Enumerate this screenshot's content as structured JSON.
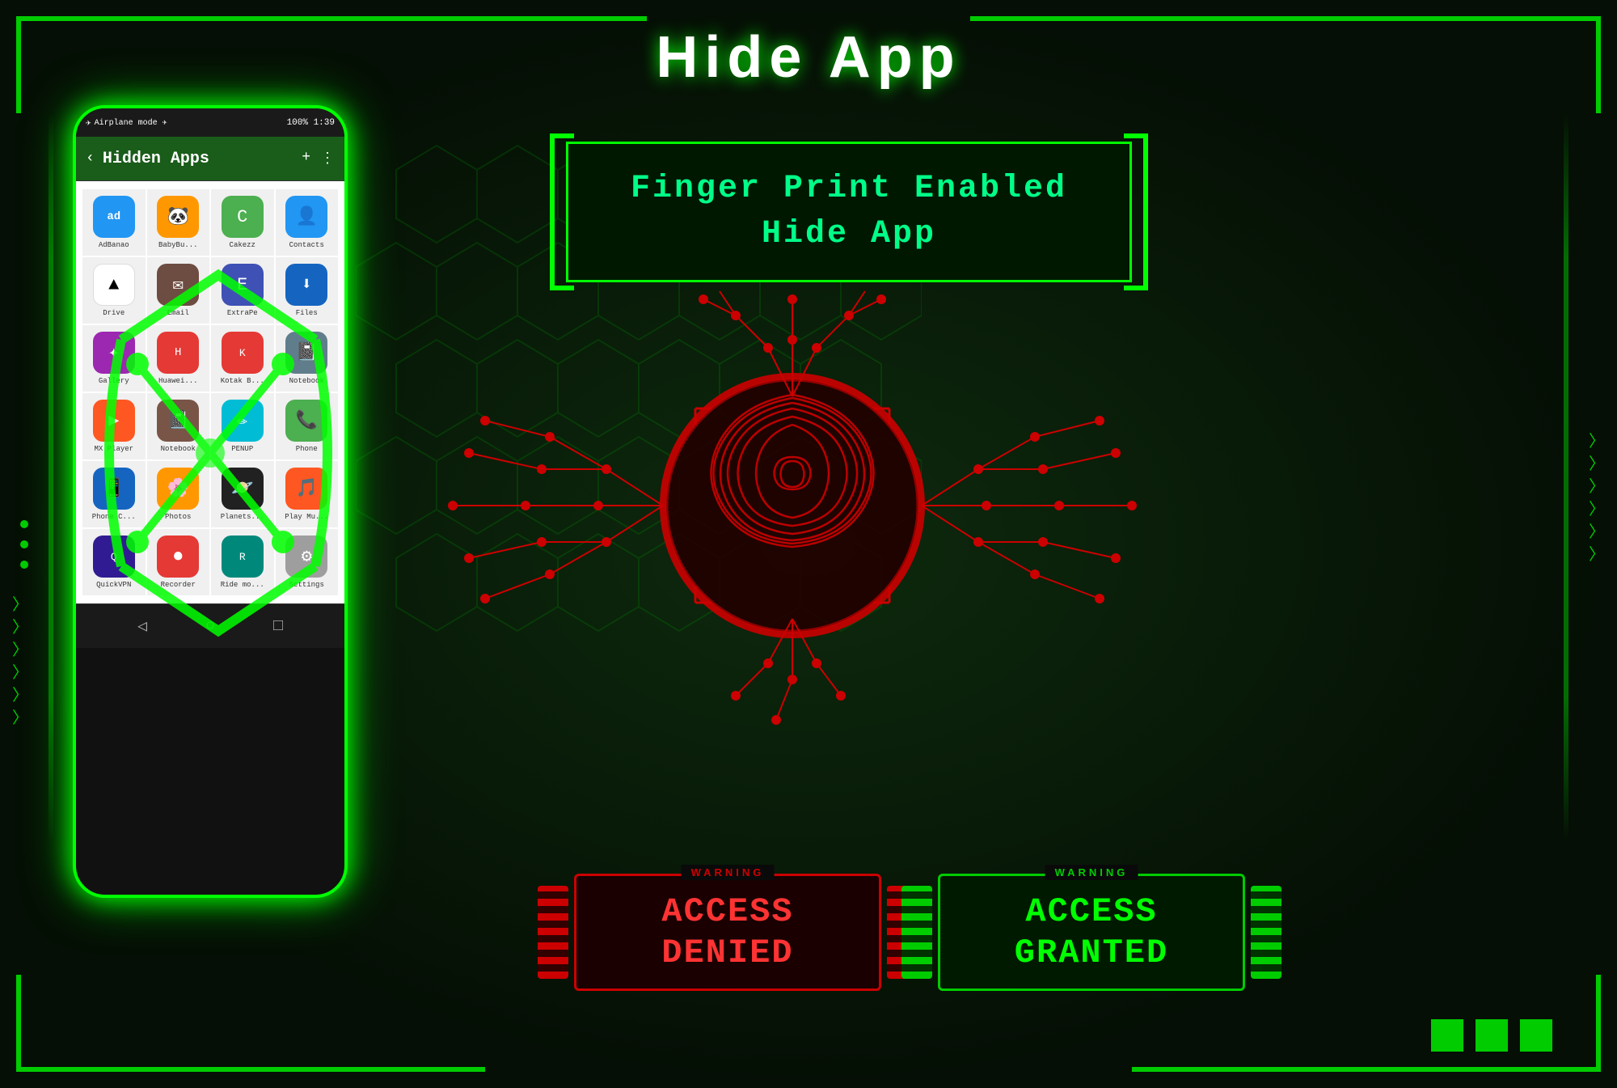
{
  "page": {
    "title": "Hide App",
    "background_color": "#0a1a0a"
  },
  "phone": {
    "status_bar": {
      "left": "Airplane mode ✈",
      "right": "100% 1:39"
    },
    "header": {
      "title": "Hidden Apps",
      "back_icon": "‹",
      "add_icon": "+",
      "more_icon": "⋮"
    },
    "apps": [
      {
        "label": "AdBanao",
        "icon": "ad",
        "color": "icon-ad"
      },
      {
        "label": "BabyBu...",
        "icon": "🐼",
        "color": "icon-baby"
      },
      {
        "label": "Cakezz",
        "icon": "C",
        "color": "icon-cake"
      },
      {
        "label": "Contacts",
        "icon": "👤",
        "color": "icon-contacts"
      },
      {
        "label": "Drive",
        "icon": "▲",
        "color": "icon-drive"
      },
      {
        "label": "Email",
        "icon": "✉",
        "color": "icon-email"
      },
      {
        "label": "ExtraPe",
        "icon": "E",
        "color": "icon-extrap"
      },
      {
        "label": "Files",
        "icon": "⬇",
        "color": "icon-files"
      },
      {
        "label": "Gallery",
        "icon": "✦",
        "color": "icon-gallery"
      },
      {
        "label": "Huawei...",
        "icon": "H",
        "color": "icon-huawei"
      },
      {
        "label": "Kotak B...",
        "icon": "K",
        "color": "icon-kotak"
      },
      {
        "label": "Notebook",
        "icon": "📓",
        "color": "icon-notebook"
      },
      {
        "label": "MX Player",
        "icon": "▶",
        "color": "icon-mx"
      },
      {
        "label": "Notebook",
        "icon": "📓",
        "color": "icon-notebook2"
      },
      {
        "label": "PENUP",
        "icon": "✏",
        "color": "icon-penup"
      },
      {
        "label": "Phone",
        "icon": "📞",
        "color": "icon-phone"
      },
      {
        "label": "Phone C...",
        "icon": "📱",
        "color": "icon-phonec"
      },
      {
        "label": "Photos",
        "icon": "🌸",
        "color": "icon-photos"
      },
      {
        "label": "Planets...",
        "icon": "🪐",
        "color": "icon-planets"
      },
      {
        "label": "Play Mu...",
        "icon": "🎵",
        "color": "icon-playmu"
      },
      {
        "label": "QuickVPN",
        "icon": "Q",
        "color": "icon-qvpn"
      },
      {
        "label": "Recorder",
        "icon": "⏺",
        "color": "icon-recorder"
      },
      {
        "label": "Ride mo...",
        "icon": "R",
        "color": "icon-ridem"
      },
      {
        "label": "Settings",
        "icon": "⚙",
        "color": "icon-settings"
      }
    ],
    "nav": {
      "back": "◁",
      "home": "○",
      "recent": "□"
    }
  },
  "fingerprint_section": {
    "title_line1": "Finger Print Enabled",
    "title_line2": "Hide App"
  },
  "badges": {
    "denied": {
      "warning": "WARNING",
      "line1": "ACCESS",
      "line2": "DENIED"
    },
    "granted": {
      "warning": "WARNING",
      "line1": "ACCESS",
      "line2": "GRANTED"
    }
  },
  "decorations": {
    "bottom_squares": 3,
    "accent_color": "#00cc00",
    "danger_color": "#cc0000"
  }
}
